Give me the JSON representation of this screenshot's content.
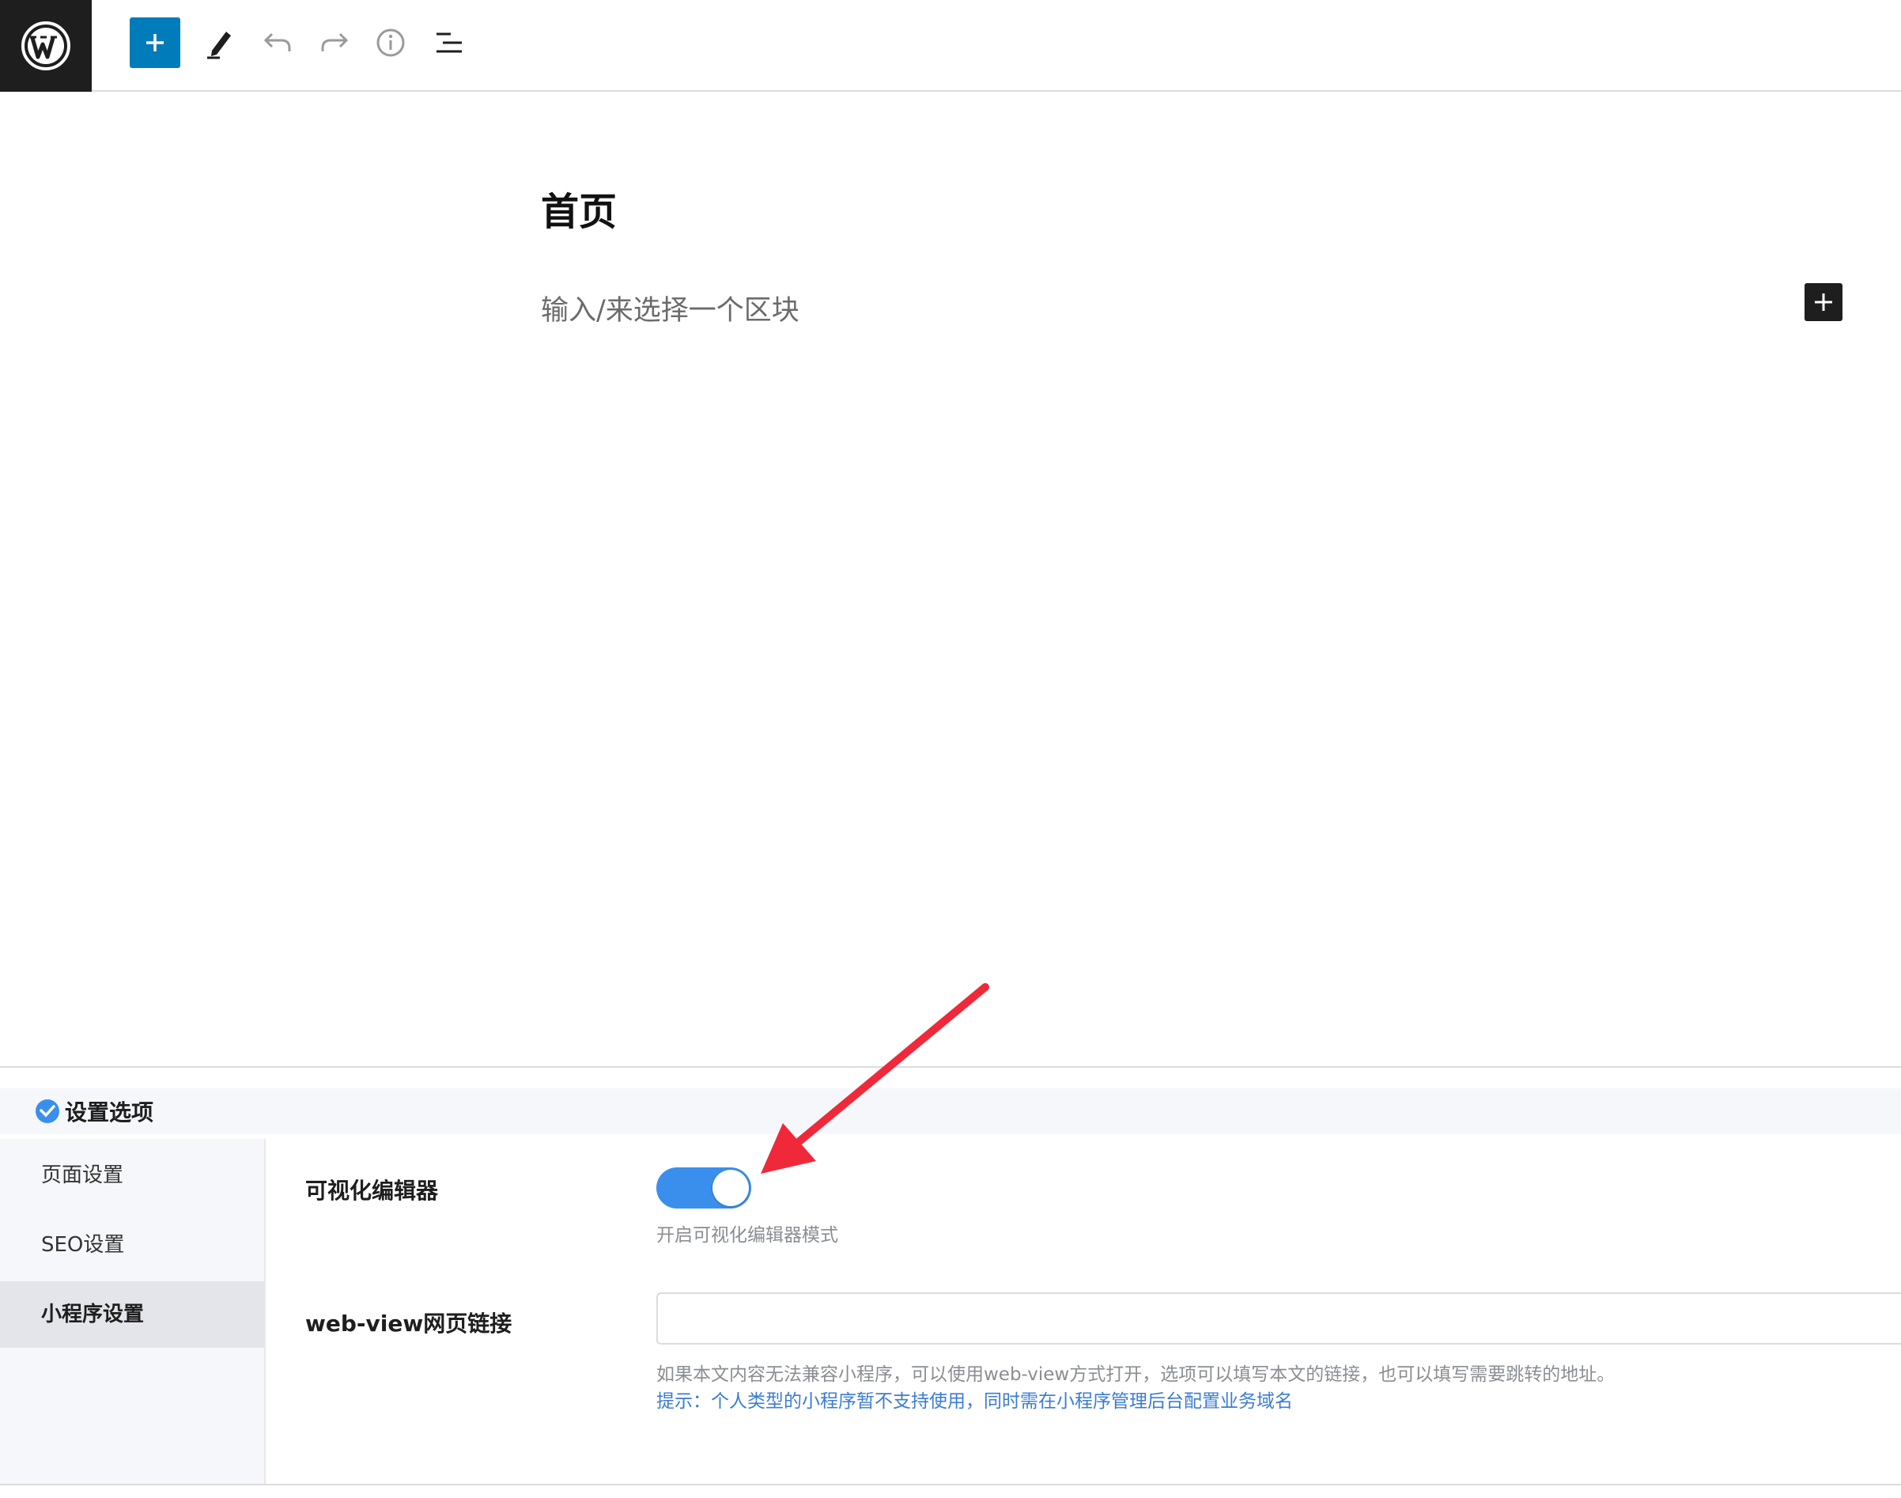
{
  "toolbar": {
    "logo_icon": "wordpress-icon",
    "add_block_icon": "plus-icon",
    "tools_icon": "pencil-icon",
    "undo_icon": "undo-icon",
    "redo_icon": "redo-icon",
    "details_icon": "info-icon",
    "list_view_icon": "list-view-icon",
    "accent": "#007cba"
  },
  "editor": {
    "title": "首页",
    "block_placeholder": "输入/来选择一个区块"
  },
  "meta_box": {
    "title": "设置选项",
    "nav": [
      {
        "label": "页面设置",
        "active": false
      },
      {
        "label": "SEO设置",
        "active": false
      },
      {
        "label": "小程序设置",
        "active": true
      }
    ],
    "fields": {
      "visual_editor": {
        "label": "可视化编辑器",
        "enabled": true,
        "hint": "开启可视化编辑器模式"
      },
      "webview": {
        "label": "web-view网页链接",
        "value": "",
        "hint": "如果本文内容无法兼容小程序，可以使用web-view方式打开，选项可以填写本文的链接，也可以填写需要跳转的地址。",
        "tip": "提示：个人类型的小程序暂不支持使用，同时需在小程序管理后台配置业务域名"
      }
    },
    "toggle_color": "#3b8fec",
    "annotation_color": "#f0293a"
  }
}
